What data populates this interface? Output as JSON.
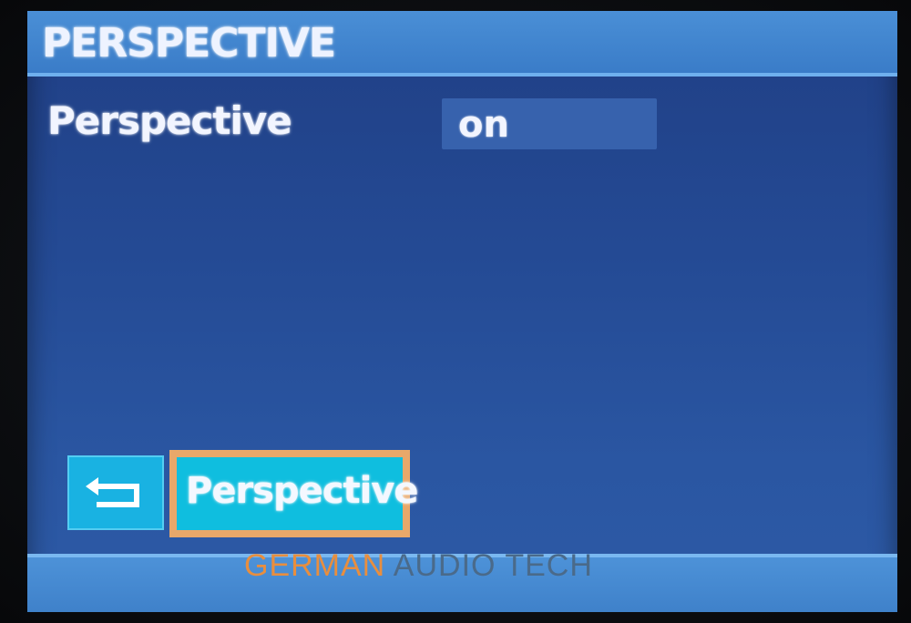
{
  "header": {
    "title": "PERSPECTIVE"
  },
  "settings": [
    {
      "label": "Perspective",
      "value": "on"
    }
  ],
  "footer": {
    "back_icon": "back-arrow-icon",
    "active_button_label": "Perspective"
  },
  "watermark": {
    "part1": "GERMAN",
    "part2": " AUDIO TECH"
  },
  "colors": {
    "screen_bg": "#244a94",
    "title_bar": "#3a7cc8",
    "value_field": "#3762ad",
    "button_cyan": "#0fbedf",
    "selection_border": "#e8a86a"
  }
}
